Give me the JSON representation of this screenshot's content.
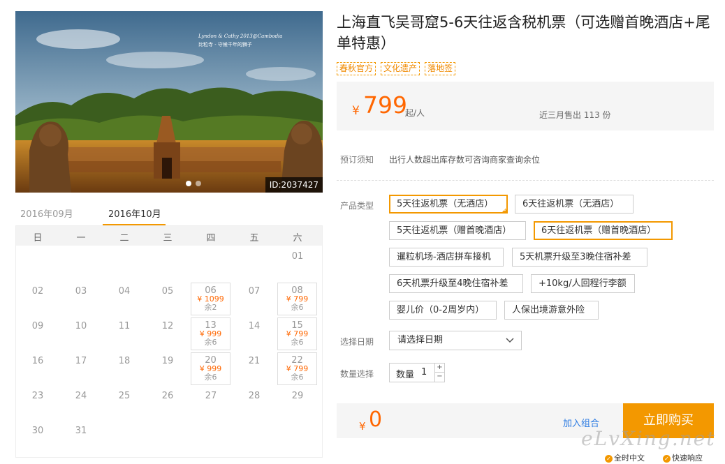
{
  "hero": {
    "caption_en": "Lyndon & Cathy 2013@Cambodia",
    "caption_cn": "比粒寺 - 守候千年的狮子",
    "id_label": "ID:2037427"
  },
  "calendar": {
    "tabs": [
      "2016年09月",
      "2016年10月"
    ],
    "weekdays": [
      "日",
      "一",
      "二",
      "三",
      "四",
      "五",
      "六"
    ],
    "days": [
      {
        "d": "01",
        "col": 6,
        "row": 0
      },
      {
        "d": "02",
        "col": 0,
        "row": 1
      },
      {
        "d": "03",
        "col": 1,
        "row": 1
      },
      {
        "d": "04",
        "col": 2,
        "row": 1
      },
      {
        "d": "05",
        "col": 3,
        "row": 1
      },
      {
        "d": "06",
        "col": 4,
        "row": 1,
        "price": "¥ 1099",
        "remain": "余2"
      },
      {
        "d": "07",
        "col": 5,
        "row": 1
      },
      {
        "d": "08",
        "col": 6,
        "row": 1,
        "price": "¥ 799",
        "remain": "余6"
      },
      {
        "d": "09",
        "col": 0,
        "row": 2
      },
      {
        "d": "10",
        "col": 1,
        "row": 2
      },
      {
        "d": "11",
        "col": 2,
        "row": 2
      },
      {
        "d": "12",
        "col": 3,
        "row": 2
      },
      {
        "d": "13",
        "col": 4,
        "row": 2,
        "price": "¥ 999",
        "remain": "余6"
      },
      {
        "d": "14",
        "col": 5,
        "row": 2
      },
      {
        "d": "15",
        "col": 6,
        "row": 2,
        "price": "¥ 799",
        "remain": "余6"
      },
      {
        "d": "16",
        "col": 0,
        "row": 3
      },
      {
        "d": "17",
        "col": 1,
        "row": 3
      },
      {
        "d": "18",
        "col": 2,
        "row": 3
      },
      {
        "d": "19",
        "col": 3,
        "row": 3
      },
      {
        "d": "20",
        "col": 4,
        "row": 3,
        "price": "¥ 999",
        "remain": "余6"
      },
      {
        "d": "21",
        "col": 5,
        "row": 3
      },
      {
        "d": "22",
        "col": 6,
        "row": 3,
        "price": "¥ 799",
        "remain": "余6"
      },
      {
        "d": "23",
        "col": 0,
        "row": 4
      },
      {
        "d": "24",
        "col": 1,
        "row": 4
      },
      {
        "d": "25",
        "col": 2,
        "row": 4
      },
      {
        "d": "26",
        "col": 3,
        "row": 4
      },
      {
        "d": "27",
        "col": 4,
        "row": 4
      },
      {
        "d": "28",
        "col": 5,
        "row": 4
      },
      {
        "d": "29",
        "col": 6,
        "row": 4
      },
      {
        "d": "30",
        "col": 0,
        "row": 5
      },
      {
        "d": "31",
        "col": 1,
        "row": 5
      }
    ]
  },
  "product": {
    "title": "上海直飞吴哥窟5-6天往返含税机票（可选赠首晚酒店+尾单特惠）",
    "tags": [
      "春秋官方",
      "文化遗产",
      "落地签"
    ],
    "price_symbol": "¥",
    "price": "799",
    "price_unit": "起/人",
    "sold": "近三月售出 113 份"
  },
  "booking": {
    "note_label": "预订须知",
    "note_text": "出行人数超出库存数可咨询商家查询余位",
    "type_label": "产品类型",
    "options": [
      {
        "label": "5天往返机票（无酒店）",
        "selected": true,
        "checked": true
      },
      {
        "label": "6天往返机票（无酒店）",
        "selected": false
      },
      {
        "label": "5天往返机票（赠首晚酒店）",
        "selected": false
      },
      {
        "label": "6天往返机票（赠首晚酒店）",
        "selected": true
      },
      {
        "label": "暹粒机场-酒店拼车接机",
        "selected": false
      },
      {
        "label": "5天机票升级至3晚住宿补差",
        "selected": false
      },
      {
        "label": "6天机票升级至4晚住宿补差",
        "selected": false
      },
      {
        "label": "+10kg/人回程行李额",
        "selected": false
      },
      {
        "label": "婴儿价（0-2周岁内）",
        "selected": false
      },
      {
        "label": "人保出境游意外险",
        "selected": false
      }
    ],
    "date_label": "选择日期",
    "date_placeholder": "请选择日期",
    "qty_label": "数量选择",
    "qty_field_label": "数量",
    "qty_value": "1",
    "qty_plus": "+",
    "qty_minus": "−"
  },
  "buy": {
    "total_symbol": "¥",
    "total": "0",
    "combo_label": "加入组合",
    "buy_label": "立即购买"
  },
  "footer": {
    "watermark": "eLvXing.net",
    "badges": [
      "全时中文",
      "快速响应"
    ]
  },
  "colors": {
    "accent": "#f39800",
    "price": "#ff6600",
    "link": "#2a7ae2"
  }
}
